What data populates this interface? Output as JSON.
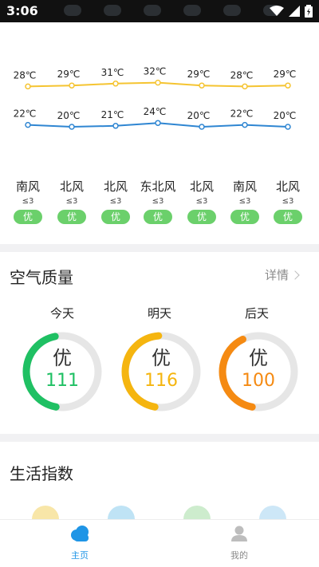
{
  "status": {
    "time": "3:06"
  },
  "forecast": [
    {
      "high": "28℃",
      "low": "22℃",
      "wind": "南风",
      "level": "≤3",
      "aq": "优"
    },
    {
      "high": "29℃",
      "low": "20℃",
      "wind": "北风",
      "level": "≤3",
      "aq": "优"
    },
    {
      "high": "31℃",
      "low": "21℃",
      "wind": "北风",
      "level": "≤3",
      "aq": "优"
    },
    {
      "high": "32℃",
      "low": "24℃",
      "wind": "东北风",
      "level": "≤3",
      "aq": "优"
    },
    {
      "high": "29℃",
      "low": "20℃",
      "wind": "北风",
      "level": "≤3",
      "aq": "优"
    },
    {
      "high": "28℃",
      "low": "22℃",
      "wind": "南风",
      "level": "≤3",
      "aq": "优"
    },
    {
      "high": "29℃",
      "low": "20℃",
      "wind": "北风",
      "level": "≤3",
      "aq": "优"
    }
  ],
  "colors": {
    "high_line": "#f5c431",
    "low_line": "#2f86d2",
    "aq_good": "#6bd06b",
    "today": "#1fc063",
    "tomorrow": "#f5b50f",
    "after": "#f58a12",
    "track": "#e6e6e6",
    "tab_active": "#1f95e6",
    "tab_inactive": "#8a8a8a"
  },
  "air_quality": {
    "title": "空气质量",
    "detail": "详情",
    "days": [
      {
        "label": "今天",
        "level": "优",
        "aqi": "111",
        "fraction": 0.44
      },
      {
        "label": "明天",
        "level": "优",
        "aqi": "116",
        "fraction": 0.46
      },
      {
        "label": "后天",
        "level": "优",
        "aqi": "100",
        "fraction": 0.4
      }
    ]
  },
  "life_index": {
    "title": "生活指数"
  },
  "tabs": {
    "home": "主页",
    "mine": "我的"
  },
  "icons": {
    "status_weather": "cloud-icon",
    "wifi": "wifi-icon",
    "signal": "signal-icon",
    "battery": "battery-icon",
    "home": "cloud-home-icon",
    "mine": "user-icon",
    "detail": "chevron-right-icon"
  }
}
